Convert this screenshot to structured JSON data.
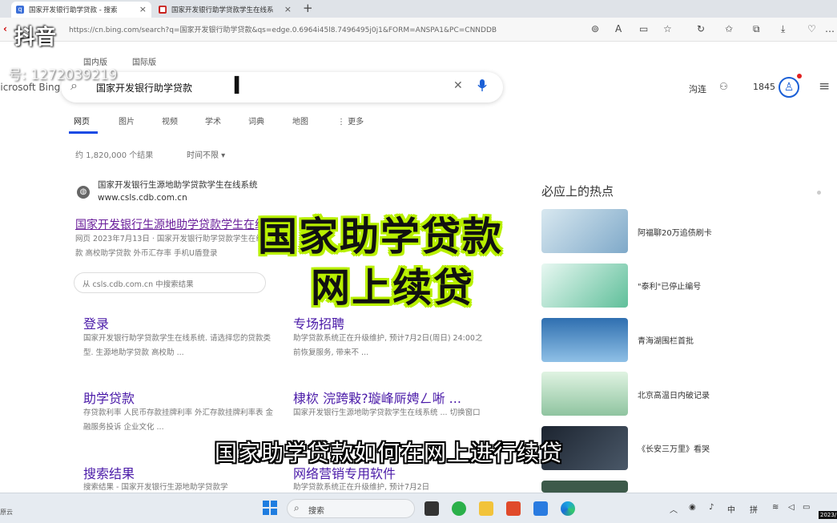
{
  "browser": {
    "tabs": [
      {
        "title": "国家开发银行助学贷款 - 搜索",
        "active": true
      },
      {
        "title": "国家开发银行助学贷款学生在线系",
        "active": false
      }
    ],
    "new_tab": "+",
    "url": "https://cn.bing.com/search?q=国家开发银行助学贷款&qs=edge.0.6964i45l8.7496495j0j1&FORM=ANSPA1&PC=CNNDDB"
  },
  "bing": {
    "region_tabs": [
      "国内版",
      "国际版"
    ],
    "logo": "Microsoft Bing",
    "query": "国家开发银行助学贷款",
    "user_label": "沟连",
    "points": "1845",
    "nav": [
      "网页",
      "图片",
      "视频",
      "学术",
      "词典",
      "地图",
      "⋮ 更多"
    ],
    "result_count": "约 1,820,000 个结果",
    "time_filter": "时间不限 ▾"
  },
  "result": {
    "site_title": "国家开发银行生源地助学贷款学生在线系统",
    "site_url": "www.csls.cdb.com.cn",
    "link": "国家开发银行生源地助学贷款学生在线系统",
    "snippet_1": "网页  2023年7月13日 · 国家开发银行助学贷款学生在线系统",
    "snippet_2": "款 高校助学贷款 外币汇存率 手机U盾登录",
    "site_search_placeholder": "从 csls.cdb.com.cn 中搜索结果",
    "deep_links": [
      {
        "title": "登录",
        "desc": "国家开发银行助学贷款学生在线系统. 请选择您的贷款类型. 生源地助学贷款 高校助 ..."
      },
      {
        "title": "专场招聘",
        "desc": "助学贷款系统正在升级维护, 预计7月2日(周日) 24:00之前恢复服务, 带来不 ..."
      },
      {
        "title": "助学贷款",
        "desc": "存贷款利率 人民币存款挂牌利率 外汇存款挂牌利率表 金融服务投诉 企业文化 ..."
      },
      {
        "title": "棣栨 浣跨敤?璇峰厛娉ㄥ唽 ...",
        "desc": "国家开发银行生源地助学贷款学生在线系统 ... 切换窗口"
      },
      {
        "title": "搜索结果",
        "desc": "搜索结果 - 国家开发银行生源地助学贷款学"
      },
      {
        "title": "网络营销专用软件",
        "desc": "助学贷款系统正在升级维护, 预计7月2日"
      }
    ]
  },
  "hotspots": {
    "heading": "必应上的热点",
    "items": [
      {
        "text": "阿福聊20万追债刷卡",
        "color": "#7fa9c9"
      },
      {
        "text": "\"泰利\"已停止编号",
        "color": "#5fbf9a"
      },
      {
        "text": "青海湖围栏首批",
        "color": "#3f7fb8"
      },
      {
        "text": "北京高温日内破记录",
        "color": "#8fc4a0"
      },
      {
        "text": "《长安三万里》看哭",
        "color": "#2b3440"
      },
      {
        "text": "",
        "color": "#3d5a4a"
      }
    ]
  },
  "overlay": {
    "watermark": "抖音",
    "watermark_id": "号: 1272039219",
    "title_line1": "国家助学贷款",
    "title_line2": "网上续贷",
    "subtitle": "国家助学贷款如何在网上进行续贷",
    "accent": "#b8f000"
  },
  "taskbar": {
    "search": "搜索",
    "left_text": "原云",
    "tray": [
      "中",
      "拼"
    ],
    "clock": "2023/"
  }
}
